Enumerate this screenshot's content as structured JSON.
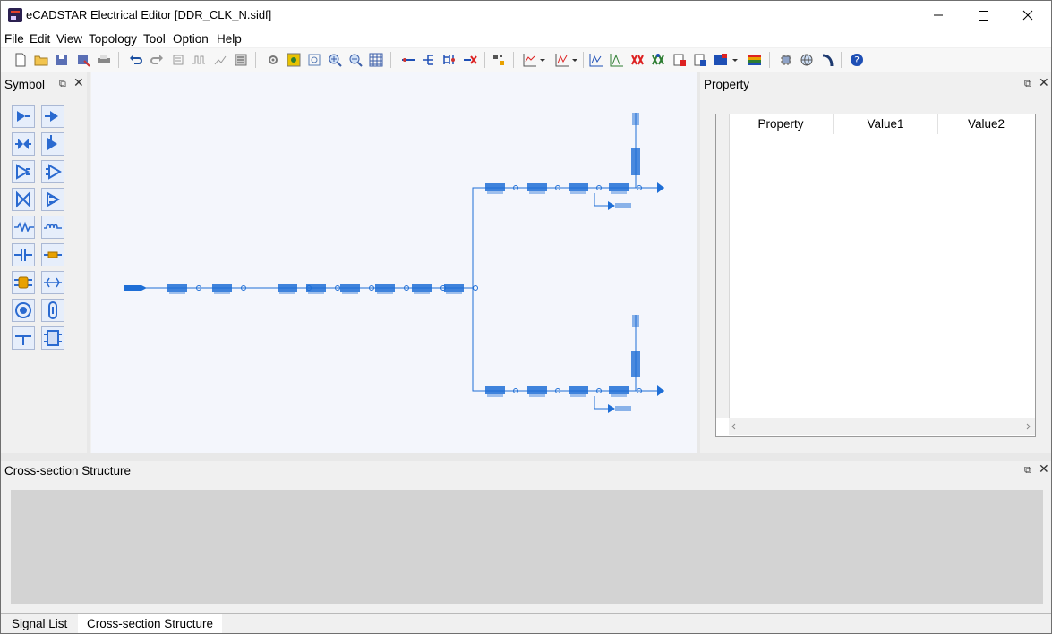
{
  "window": {
    "title": "eCADSTAR Electrical Editor [DDR_CLK_N.sidf]",
    "minimize_icon": "minimize-icon",
    "maximize_icon": "maximize-icon",
    "close_icon": "close-icon"
  },
  "menu": [
    "File",
    "Edit",
    "View",
    "Topology",
    "Tool",
    "Option",
    "Help"
  ],
  "symbol_panel": {
    "title": "Symbol"
  },
  "property_panel": {
    "title": "Property",
    "columns": [
      "Property",
      "Value1",
      "Value2"
    ]
  },
  "cross_section_panel": {
    "title": "Cross-section Structure"
  },
  "bottom_tabs": [
    "Signal List",
    "Cross-section Structure"
  ],
  "colors": {
    "accent": "#1e6ed6",
    "canvas_bg": "#f4f6fc",
    "wire": "#1e6ed6"
  }
}
